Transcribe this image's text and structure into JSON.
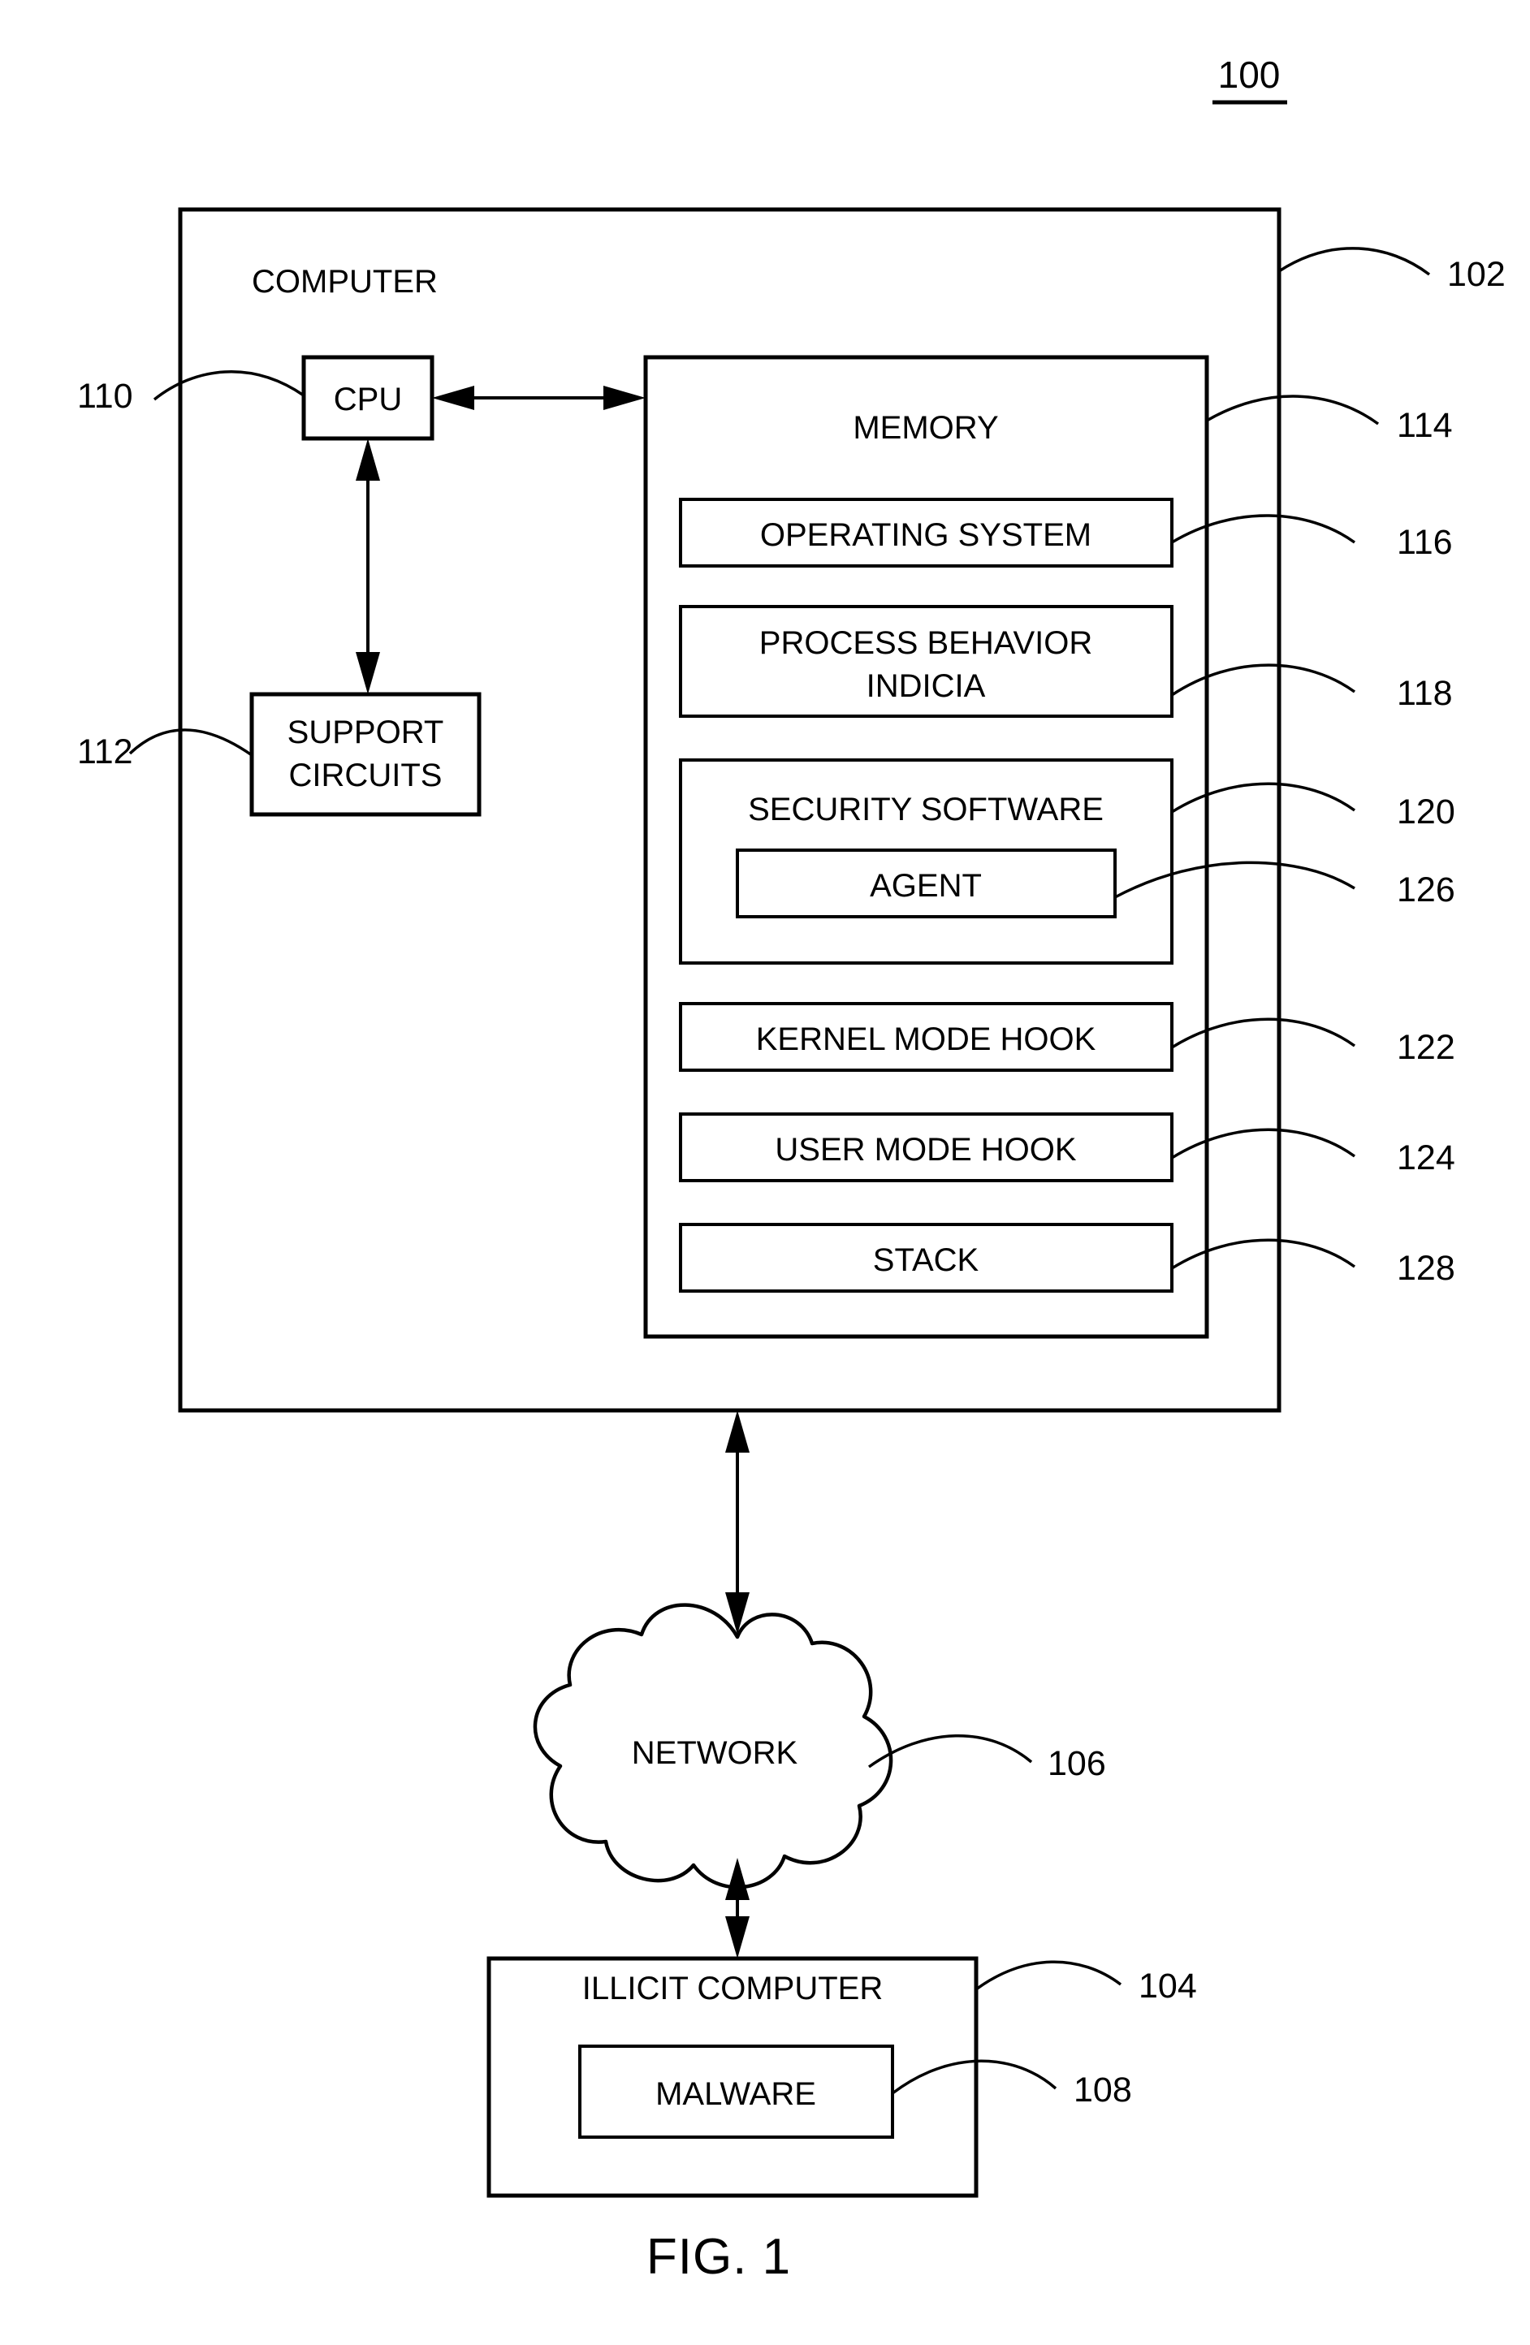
{
  "figure": {
    "caption": "FIG. 1",
    "system_number": "100"
  },
  "nodes": {
    "computer": {
      "label": "COMPUTER",
      "ref": "102"
    },
    "cpu": {
      "label": "CPU",
      "ref": "110"
    },
    "support_circuits": {
      "label_line1": "SUPPORT",
      "label_line2": "CIRCUITS",
      "ref": "112"
    },
    "memory": {
      "label": "MEMORY",
      "ref": "114",
      "items": [
        {
          "label": "OPERATING SYSTEM",
          "ref": "116"
        },
        {
          "label_line1": "PROCESS BEHAVIOR",
          "label_line2": "INDICIA",
          "ref": "118"
        },
        {
          "label": "SECURITY SOFTWARE",
          "ref": "120"
        },
        {
          "label": "AGENT",
          "ref": "126"
        },
        {
          "label": "KERNEL MODE HOOK",
          "ref": "122"
        },
        {
          "label": "USER MODE HOOK",
          "ref": "124"
        },
        {
          "label": "STACK",
          "ref": "128"
        }
      ]
    },
    "network": {
      "label": "NETWORK",
      "ref": "106"
    },
    "illicit_computer": {
      "label": "ILLICIT COMPUTER",
      "ref": "104"
    },
    "malware": {
      "label": "MALWARE",
      "ref": "108"
    }
  },
  "colors": {
    "line": "#000000",
    "background": "#ffffff"
  }
}
